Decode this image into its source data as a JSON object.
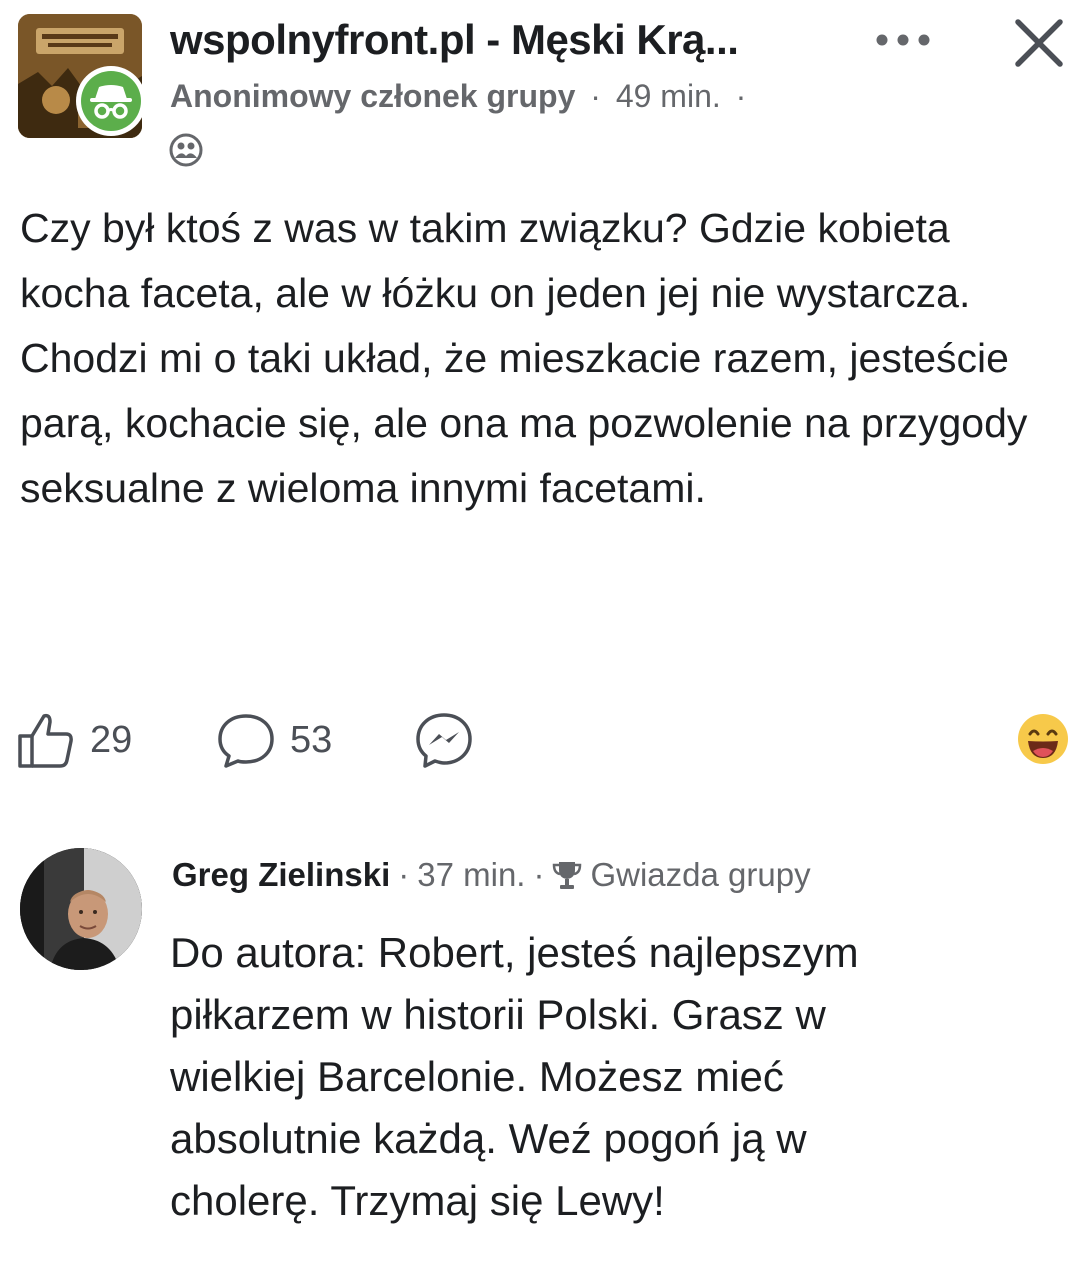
{
  "header": {
    "group_name": "wspolnyfront.pl - Męski Krą...",
    "author": "Anonimowy członek grupy",
    "separator": "·",
    "time": "49 min.",
    "trailing_dot": "·",
    "icons": {
      "group_avatar": "group-photo-icon",
      "anonymous_badge": "incognito-icon",
      "more": "more-icon",
      "close": "close-icon",
      "privacy": "group-members-icon"
    }
  },
  "post": {
    "paragraphs": [
      "Czy był ktoś z was w takim związku? Gdzie kobieta kocha faceta, ale w łóżku on jeden jej nie wystarcza.",
      "Chodzi mi o taki układ, że mieszkacie razem, jesteście parą, kochacie się, ale ona ma pozwolenie na przygody seksualne z wieloma innymi facetami."
    ]
  },
  "actions": {
    "likes": "29",
    "comments": "53",
    "icons": {
      "like": "thumbs-up-icon",
      "comment": "comment-bubble-icon",
      "share": "messenger-icon",
      "reaction": "laughing-emoji-icon"
    }
  },
  "comment": {
    "name": "Greg Zielinski",
    "separator": "·",
    "time": "37 min.",
    "badge": "Gwiazda grupy",
    "badge_icon": "trophy-icon",
    "lines": [
      "Do autora: Robert, jesteś najlepszym",
      "piłkarzem w historii Polski. Grasz w",
      "wielkiej Barcelonie. Możesz mieć",
      "absolutnie każdą. Weź pogoń ją w",
      "cholerę. Trzymaj się Lewy!"
    ]
  },
  "colors": {
    "text_primary": "#1c1e21",
    "text_secondary": "#65676b",
    "anon_badge_green": "#5cae4b",
    "icon_gray": "#4b4f56"
  }
}
